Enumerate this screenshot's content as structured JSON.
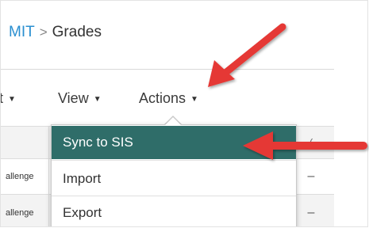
{
  "breadcrumb": {
    "parent": "MIT",
    "separator": ">",
    "current": "Grades"
  },
  "toolbar": {
    "cut_label": "t",
    "view_label": "View",
    "actions_label": "Actions",
    "caret": "▼"
  },
  "grid": {
    "header_dash": "(",
    "rows": [
      {
        "label": "allenge",
        "value": "–"
      },
      {
        "label": "allenge",
        "value": "–"
      }
    ]
  },
  "menu": {
    "items": [
      {
        "label": "Sync to SIS",
        "active": true
      },
      {
        "label": "Import"
      },
      {
        "label": "Export"
      }
    ]
  },
  "colors": {
    "accent": "#2f6d69",
    "arrow": "#e53935",
    "link": "#2a8fd0"
  }
}
